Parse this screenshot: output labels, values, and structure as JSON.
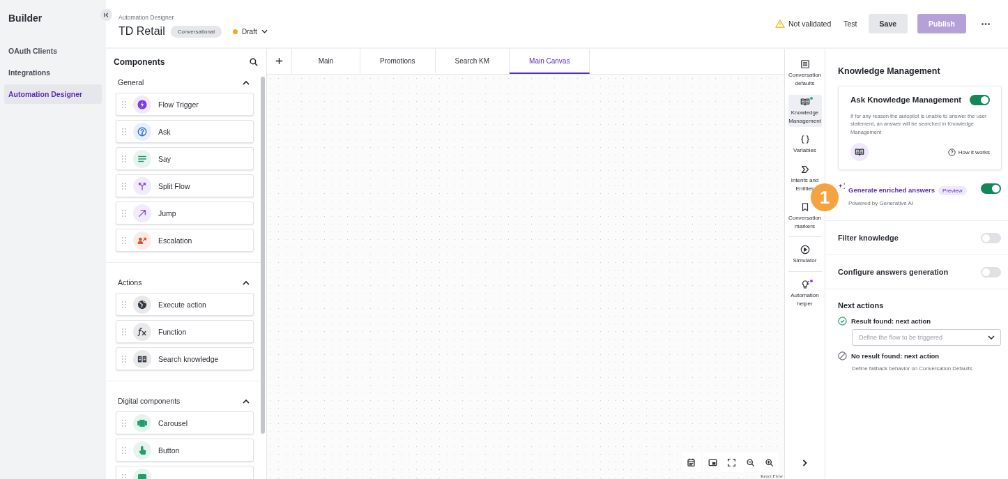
{
  "nav": {
    "title": "Builder",
    "items": [
      {
        "label": "OAuth Clients",
        "selected": false
      },
      {
        "label": "Integrations",
        "selected": false
      },
      {
        "label": "Automation Designer",
        "selected": true
      }
    ]
  },
  "header": {
    "breadcrumb": "Automation Designer",
    "title": "TD Retail",
    "type_chip": "Conversational",
    "status": {
      "label": "Draft",
      "color": "#f5a623"
    },
    "validation": "Not validated",
    "test": "Test",
    "save": "Save",
    "publish": {
      "label": "Publish",
      "disabled": true
    }
  },
  "components": {
    "title": "Components",
    "sections": [
      {
        "title": "General",
        "expanded": true,
        "items": [
          {
            "label": "Flow Trigger",
            "kind": "bolt",
            "color": "#7b3fe4"
          },
          {
            "label": "Ask",
            "kind": "question",
            "color": "#2f6fd8"
          },
          {
            "label": "Say",
            "kind": "lines",
            "color": "#1f9d6b"
          },
          {
            "label": "Split Flow",
            "kind": "split",
            "color": "#8a4be0"
          },
          {
            "label": "Jump",
            "kind": "arrow",
            "color": "#8a4be0"
          },
          {
            "label": "Escalation",
            "kind": "escalation",
            "color": "#e0552f"
          }
        ]
      },
      {
        "title": "Actions",
        "expanded": true,
        "items": [
          {
            "label": "Execute action",
            "kind": "globe",
            "color": "#333a44"
          },
          {
            "label": "Function",
            "kind": "fx",
            "color": "#333a44"
          },
          {
            "label": "Search knowledge",
            "kind": "book",
            "color": "#333a44"
          }
        ]
      },
      {
        "title": "Digital components",
        "expanded": true,
        "items": [
          {
            "label": "Carousel",
            "kind": "carousel",
            "color": "#1f9d6b"
          },
          {
            "label": "Button",
            "kind": "touch",
            "color": "#1f9d6b"
          },
          {
            "kind": "quick",
            "color": "#1f9d6b"
          }
        ]
      }
    ]
  },
  "tabs": [
    {
      "label": "Main",
      "selected": false
    },
    {
      "label": "Promotions",
      "selected": false
    },
    {
      "label": "Search KM",
      "selected": false
    },
    {
      "label": "Main Canvas",
      "selected": true
    }
  ],
  "canvas": {
    "attribution": "React Flow",
    "controls": [
      {
        "kind": "calendar"
      },
      {
        "kind": "minimap"
      },
      {
        "kind": "fit"
      },
      {
        "kind": "zoom-out"
      },
      {
        "kind": "zoom-in"
      }
    ]
  },
  "rail": {
    "items": [
      {
        "label": "Conversation defaults",
        "kind": "list",
        "selected": false
      },
      {
        "label": "Knowledge Management",
        "kind": "book",
        "selected": true,
        "color": "#1db46e"
      },
      {
        "label": "Variables",
        "kind": "braces",
        "selected": false
      },
      {
        "label": "Intents and Entities",
        "kind": "intent",
        "selected": false
      },
      {
        "label": "Conversation markers",
        "kind": "bookmark",
        "selected": false
      },
      {
        "label": "Simulator",
        "kind": "play",
        "selected": false
      },
      {
        "label": "Automation helper",
        "kind": "bulb",
        "selected": false,
        "color": "#8b3dff"
      }
    ]
  },
  "settings": {
    "title": "Knowledge Management",
    "ask": {
      "title": "Ask Knowledge Management",
      "on": true,
      "description": "If for any reason the autopilot is unable to answer the user statement, an answer will be searched in Knowledge Management",
      "help": "How it works"
    },
    "enriched": {
      "title": "Generate enriched answers",
      "chip": "Preview",
      "subtitle": "Powered by Generative AI",
      "on": true
    },
    "rows": [
      {
        "label": "Filter knowledge",
        "on": false
      },
      {
        "label": "Configure answers generation",
        "on": false
      }
    ],
    "next": {
      "title": "Next actions",
      "items": [
        {
          "kind": "found",
          "label": "Result found: next action",
          "placeholder": "Define the flow to be triggered"
        },
        {
          "kind": "none",
          "label": "No result found: next action",
          "note": "Define fallback behavior on Conversation Defaults"
        }
      ]
    }
  },
  "callout": "1"
}
